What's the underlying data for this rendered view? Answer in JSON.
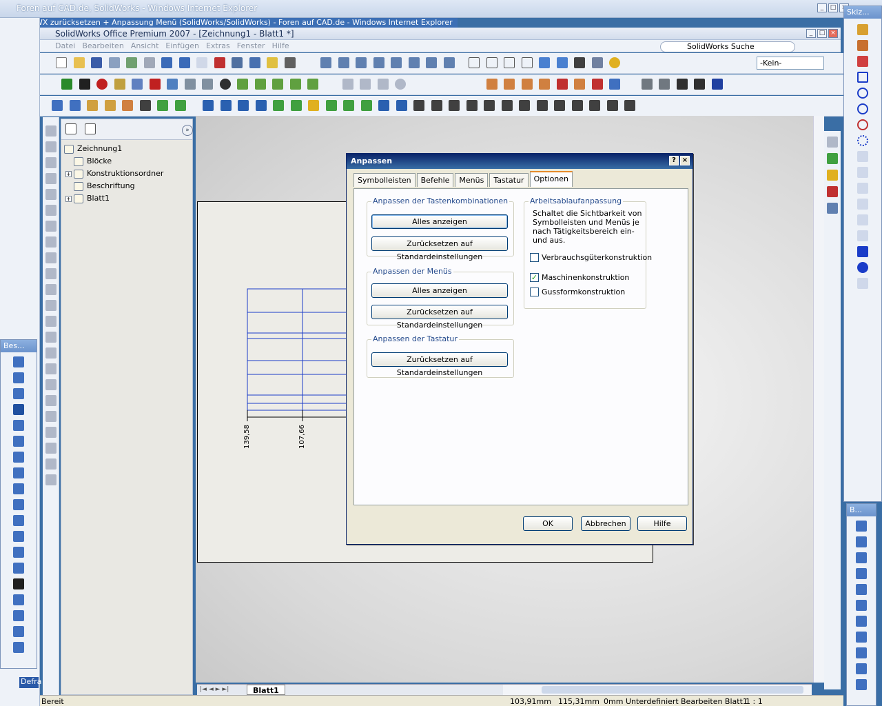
{
  "ie": {
    "title": "Foren auf CAD.de, SolidWorks - Windows Internet Explorer",
    "tab_title": "SWX zurücksetzen + Anpassung Menü (SolidWorks/SolidWorks) - Foren auf CAD.de - Windows Internet Explorer"
  },
  "sw": {
    "title": "SolidWorks Office Premium 2007 - [Zeichnung1 - Blatt1 *]",
    "menus": [
      "Datei",
      "Bearbeiten",
      "Ansicht",
      "Einfügen",
      "Extras",
      "Fenster",
      "Hilfe"
    ],
    "search_label": "SolidWorks Suche",
    "layer_combo": "-Kein-"
  },
  "feature_tree": {
    "root": "Zeichnung1",
    "items": [
      {
        "label": "Blöcke",
        "expandable": false
      },
      {
        "label": "Konstruktionsordner",
        "expandable": true
      },
      {
        "label": "Beschriftung",
        "expandable": false
      },
      {
        "label": "Blatt1",
        "expandable": true
      }
    ]
  },
  "drawing": {
    "dim1": "139,58",
    "dim2": "107,66"
  },
  "sheet_tab": "Blatt1",
  "status": {
    "left": "Bereit",
    "x": "103,91mm",
    "y": "115,31mm",
    "z": "0mm",
    "state": "Unterdefiniert",
    "mode": "Bearbeiten Blatt1",
    "scale": "1 : 1"
  },
  "floating": {
    "besch": "Bes...",
    "skizze": "Skiz...",
    "b2": "B..."
  },
  "left_taskbar": "Defra",
  "dialog": {
    "title": "Anpassen",
    "tabs": [
      "Symbolleisten",
      "Befehle",
      "Menüs",
      "Tastatur",
      "Optionen"
    ],
    "active_tab": "Optionen",
    "group_shortcuts": {
      "label": "Anpassen der Tastenkombinationen",
      "btn_show": "Alles anzeigen",
      "btn_reset": "Zurücksetzen auf Standardeinstellungen"
    },
    "group_menus": {
      "label": "Anpassen der Menüs",
      "btn_show": "Alles anzeigen",
      "btn_reset": "Zurücksetzen auf Standardeinstellungen"
    },
    "group_keyboard": {
      "label": "Anpassen der Tastatur",
      "btn_reset": "Zurücksetzen auf Standardeinstellungen"
    },
    "workflow": {
      "label": "Arbeitsablaufanpassung",
      "description": "Schaltet die Sichtbarkeit von Symbolleisten und Menüs je nach Tätigkeitsbereich ein- und aus.",
      "options": [
        {
          "label": "Verbrauchsgüterkonstruktion",
          "checked": false
        },
        {
          "label": "Maschinenkonstruktion",
          "checked": true
        },
        {
          "label": "Gussformkonstruktion",
          "checked": false
        }
      ]
    },
    "ok": "OK",
    "cancel": "Abbrechen",
    "help": "Hilfe"
  },
  "colors": {
    "accent": "#0a246a",
    "drawing_lines": "#1a3cc8"
  }
}
